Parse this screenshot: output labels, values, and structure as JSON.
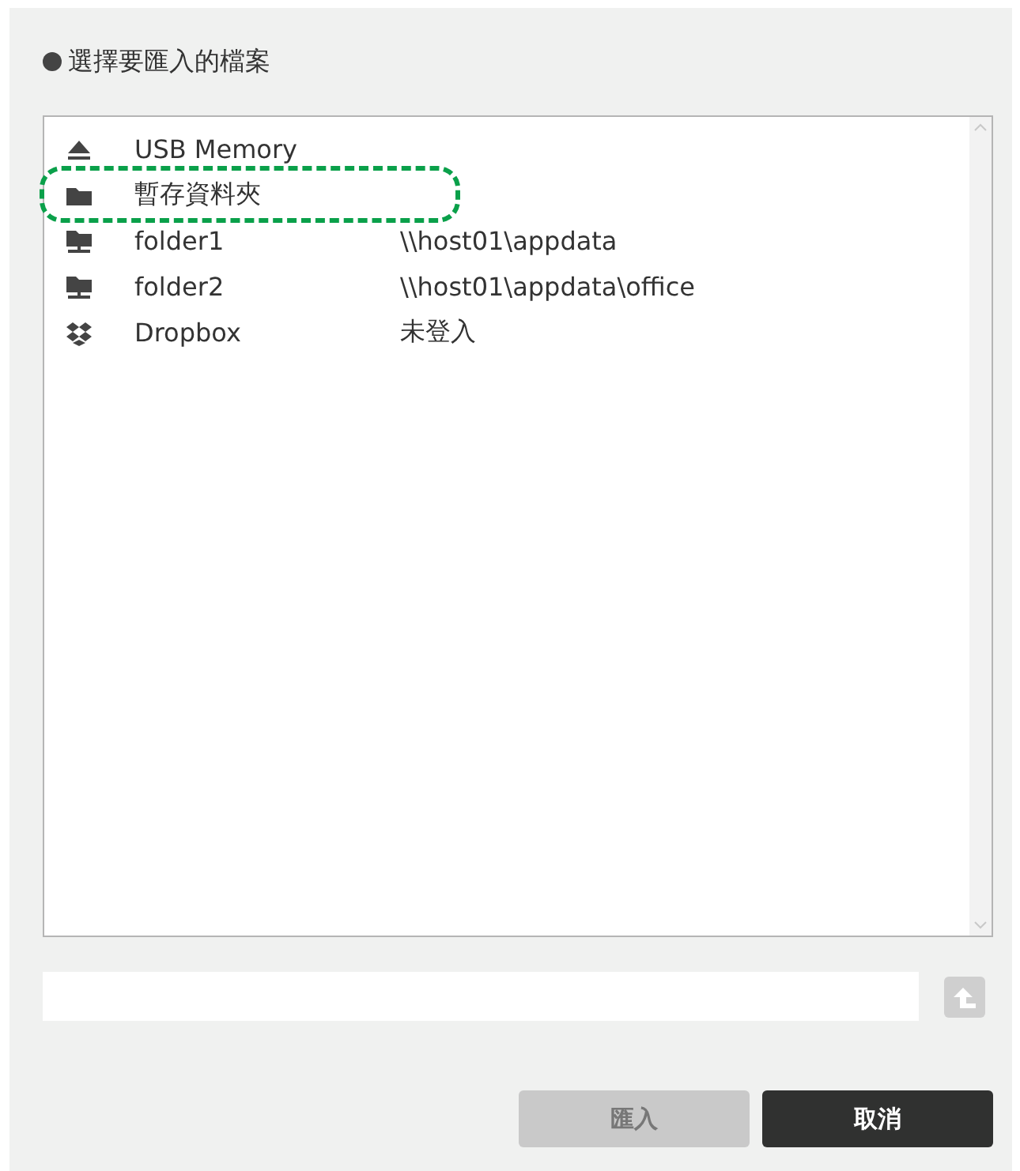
{
  "title": "選擇要匯入的檔案",
  "locations": [
    {
      "kind": "usb",
      "name": "USB Memory",
      "callout": false
    },
    {
      "kind": "folder",
      "name": "暫存資料夾",
      "callout": true
    },
    {
      "kind": "network",
      "name": "folder1",
      "path": "\\\\host01\\appdata",
      "callout": false
    },
    {
      "kind": "network",
      "name": "folder2",
      "path": "\\\\host01\\appdata\\office",
      "callout": false
    },
    {
      "kind": "dropbox",
      "name": "Dropbox",
      "path": "未登入",
      "callout": false
    }
  ],
  "buttons": [
    {
      "label": "匯入",
      "kind": "primary",
      "disabled": true
    },
    {
      "label": "取消",
      "kind": "secondary",
      "disabled": false
    }
  ]
}
